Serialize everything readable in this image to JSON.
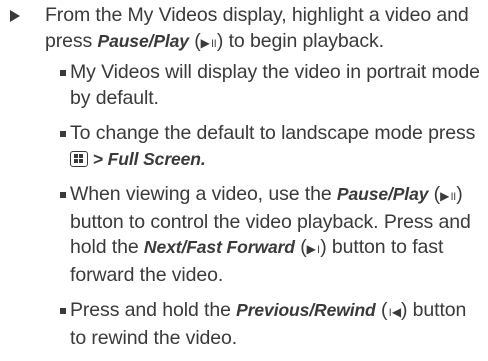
{
  "step": {
    "p1": "From the My Videos display, highlight a video and press ",
    "pause_play": "Pause/Play",
    "p2": " (",
    "pause_play_symbol": "▶॥",
    "p3": ") to begin playback."
  },
  "bullets": {
    "b1": "My Videos will display the video in portrait mode by default.",
    "b2_text": "To change the default to landscape mode press ",
    "b2_key_icon": "menu-key-icon",
    "b2_nav": " > Full Screen.",
    "b3_p1": "When viewing a video, use the ",
    "b3_pause_play": "Pause/Play",
    "b3_p2": " (",
    "b3_symbol1": "▶॥",
    "b3_p3": ") button to control the video playback. Press and hold the ",
    "b3_next": "Next/Fast Forward",
    "b3_p4": " (",
    "b3_symbol2": "▶।",
    "b3_p5": ") button to fast forward the video.",
    "b4_p1": "Press and hold the ",
    "b4_prev": "Previous/Rewind",
    "b4_p2": " (",
    "b4_symbol": "।◀",
    "b4_p3": ") button to rewind the video."
  }
}
